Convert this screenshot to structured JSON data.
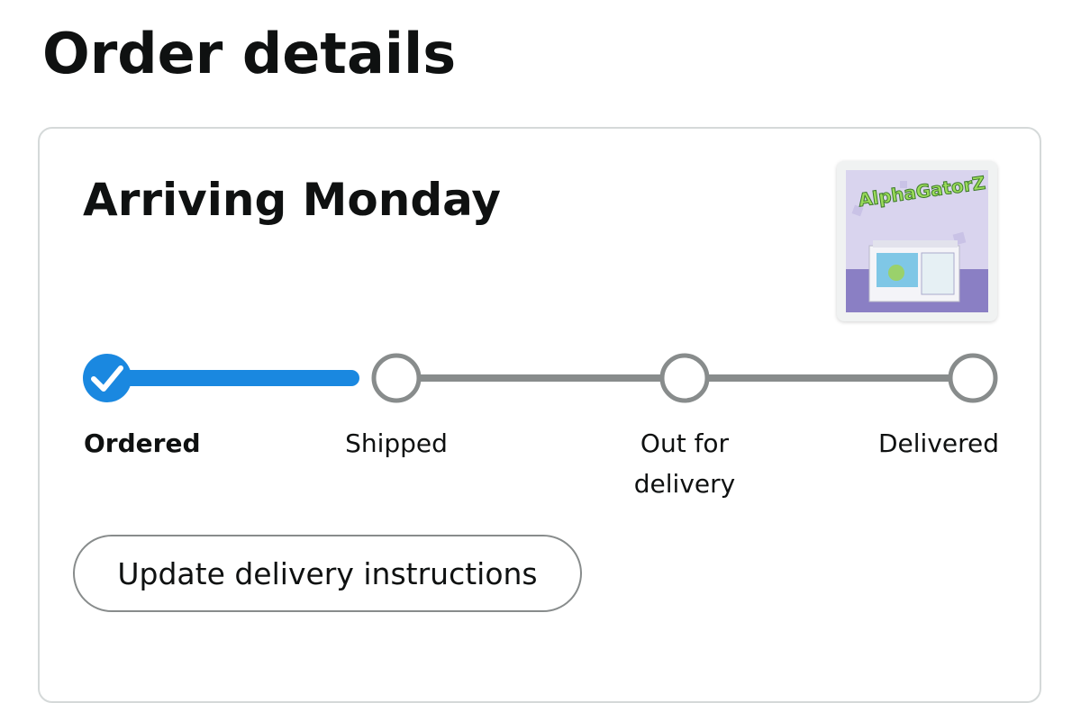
{
  "page": {
    "title": "Order details"
  },
  "order": {
    "status_headline": "Arriving Monday",
    "product_thumbnail": {
      "icon": "product-image-diaper-package",
      "brand_text": "AlphaGatorZ"
    },
    "tracker": {
      "progress": 0.16,
      "steps": [
        {
          "label": "Ordered",
          "state": "complete"
        },
        {
          "label": "Shipped",
          "state": "pending"
        },
        {
          "label_line1": "Out for",
          "label_line2": "delivery",
          "state": "pending"
        },
        {
          "label": "Delivered",
          "state": "pending"
        }
      ]
    },
    "actions": {
      "update_delivery_label": "Update delivery instructions"
    }
  },
  "colors": {
    "progress_active": "#1a88e0",
    "progress_inactive": "#888c8c",
    "card_border": "#d5d9d9"
  }
}
